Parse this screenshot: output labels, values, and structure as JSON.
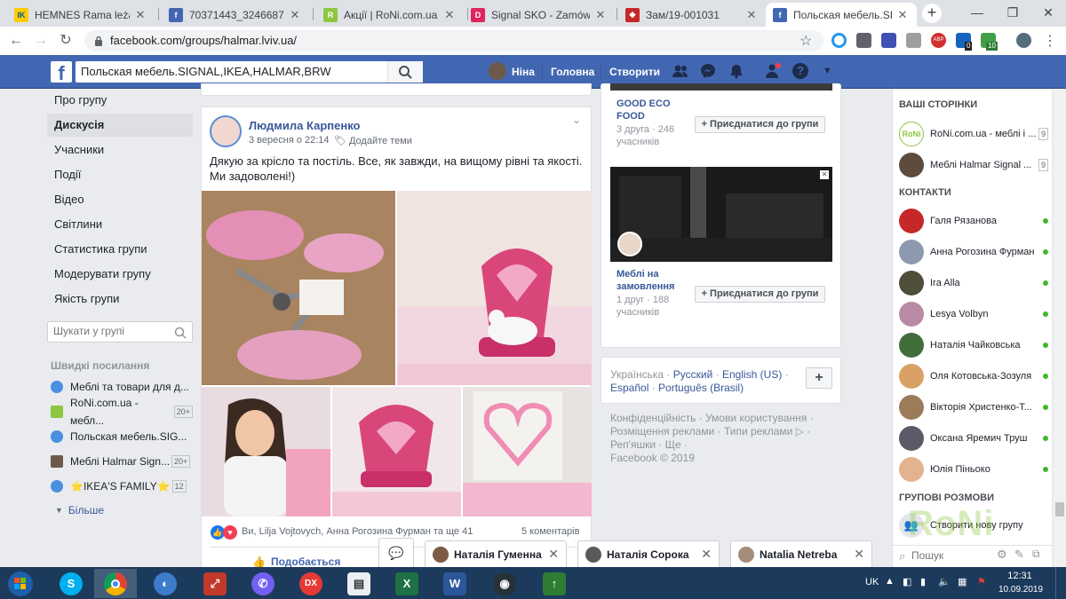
{
  "tabs": [
    {
      "title": "HEMNES Rama leżanki z",
      "close": "✕"
    },
    {
      "title": "70371443_32466871987",
      "close": "✕"
    },
    {
      "title": "Акції | RoNi.com.ua",
      "close": "✕"
    },
    {
      "title": "Signal SKO - Zamówieni",
      "close": "✕"
    },
    {
      "title": "Зам/19-001031",
      "close": "✕"
    },
    {
      "title": "Польская мебель.SIGNA",
      "close": "✕"
    }
  ],
  "browser": {
    "url": "facebook.com/groups/halmar.lviv.ua/",
    "ext_badge_1": "0",
    "ext_badge_2": "10",
    "new_tab": "+"
  },
  "header": {
    "search_value": "Польская мебель.SIGNAL,IKEA,HALMAR,BRW",
    "user": "Ніна",
    "home": "Головна",
    "create": "Створити"
  },
  "left_nav": {
    "items": [
      "Про групу",
      "Дискусія",
      "Учасники",
      "Події",
      "Відео",
      "Світлини",
      "Статистика групи",
      "Модерувати групу",
      "Якість групи"
    ],
    "search_placeholder": "Шукати у групі",
    "shortcuts_title": "Швидкі посилання",
    "shortcuts": [
      {
        "label": "Меблі та товари для д...",
        "count": ""
      },
      {
        "label": "RoNi.com.ua - мебл...",
        "count": "20+"
      },
      {
        "label": "Польская мебель.SIG...",
        "count": ""
      },
      {
        "label": "Меблі Halmar Sign...",
        "count": "20+"
      },
      {
        "label": "⭐IKEA'S FAMILY⭐",
        "count": "12"
      }
    ],
    "more": "Більше"
  },
  "post": {
    "author": "Людмила Карпенко",
    "date": "3 вересня о 22:14",
    "add_topics": "Додайте теми",
    "text": "Дякую за крісло та постіль. Все, як завжди, на вищому рівні та якості. Ми задоволені!)",
    "reactions": "Ви, Lilja Vojtovych, Анна Рогозина Фурман та ще 41",
    "comments": "5 коментарів",
    "like": "Подобається"
  },
  "suggested": [
    {
      "name": "GOOD ECO FOOD",
      "friends": "3 друга",
      "members": "· 246 учасників",
      "join": "Приєднатися до групи"
    },
    {
      "name": "Меблі на замовлення",
      "friends": "1 друг",
      "members": "· 188 учасників",
      "join": "Приєднатися до групи"
    }
  ],
  "languages": {
    "current": "Українська",
    "links": [
      "Русский",
      "English (US)",
      "Español",
      "Português (Brasil)"
    ],
    "add": "+"
  },
  "footer": {
    "links": [
      "Конфіденційність",
      "Умови користування",
      "Розміщення реклами",
      "Типи реклами ▷",
      "Реп'яшки",
      "Ще"
    ],
    "copyright": "Facebook © 2019"
  },
  "sidebar": {
    "pages_title": "ВАШІ СТОРІНКИ",
    "pages": [
      {
        "name": "RoNi.com.ua - меблі і ...",
        "count": "9"
      },
      {
        "name": "Меблі Halmar Signal ...",
        "count": "9"
      }
    ],
    "contacts_title": "КОНТАКТИ",
    "contacts": [
      "Галя Рязанова",
      "Анна Рогозина Фурман",
      "Ira Alla",
      "Lesya Volbyn",
      "Наталія Чайковська",
      "Оля Котовська-Зозуля",
      "Вікторія Христенко-Т...",
      "Оксана Яремич Труш",
      "Юлія Піньоко"
    ],
    "group_chats_title": "ГРУПОВІ РОЗМОВИ",
    "create_group": "Створити нову групу",
    "search_placeholder": "Пошук",
    "watermark": "RoNi"
  },
  "chats": [
    {
      "name": "Наталія Гуменна"
    },
    {
      "name": "Наталія Сорока"
    },
    {
      "name": "Natalia Netreba"
    }
  ],
  "taskbar": {
    "lang": "UK",
    "time": "12:31",
    "date": "10.09.2019"
  },
  "colors": {
    "fb_blue": "#4267b2",
    "link": "#385898",
    "online": "#42b72a",
    "taskbar": "#1c3a5c",
    "pink": "#d9467a"
  }
}
